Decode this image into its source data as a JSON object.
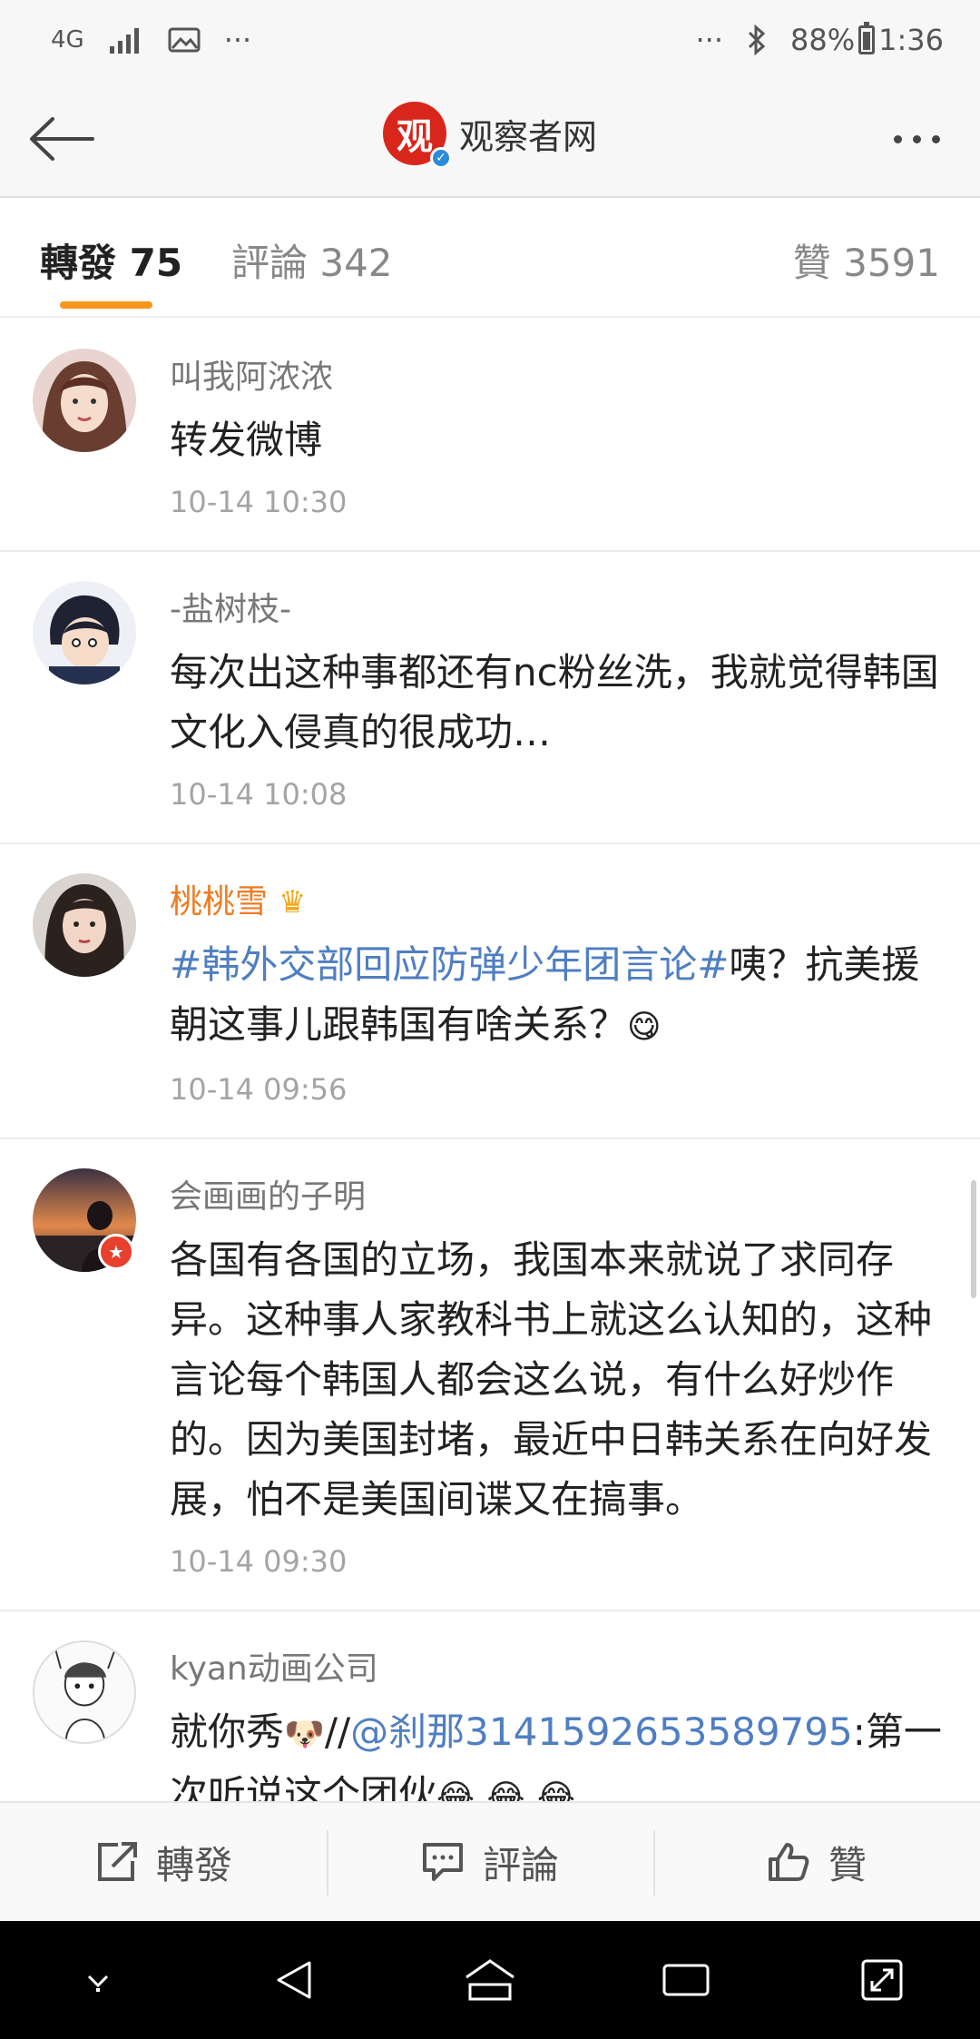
{
  "status_bar": {
    "network": "4G",
    "more_left": "···",
    "more_right": "···",
    "battery": "88%",
    "time": "1:36"
  },
  "header": {
    "title": "观察者网",
    "logo_text": "观"
  },
  "tabs": [
    {
      "label": "轉發 75",
      "active": true
    },
    {
      "label": "評論 342",
      "active": false
    },
    {
      "label": "贊 3591",
      "active": false
    }
  ],
  "comments": [
    {
      "username": "叫我阿浓浓",
      "content": "转发微博",
      "time": "10-14 10:30"
    },
    {
      "username": "-盐树枝-",
      "content": "每次出这种事都还有nc粉丝洗，我就觉得韩国文化入侵真的很成功…",
      "time": "10-14 10:08"
    },
    {
      "username": "桃桃雪",
      "topic": "#韩外交部回应防弹少年团言论#",
      "content": "咦？抗美援朝这事儿跟韩国有啥关系？",
      "time": "10-14 09:56"
    },
    {
      "username": "会画画的子明",
      "content": "各国有各国的立场，我国本来就说了求同存异。这种事人家教科书上就这么认知的，这种言论每个韩国人都会这么说，有什么好炒作的。因为美国封堵，最近中日韩关系在向好发展，怕不是美国间谍又在搞事。",
      "time": "10-14 09:30"
    },
    {
      "username": "kyan动画公司",
      "content_prefix": "就你秀",
      "separator": "//",
      "mention": "@刹那3141592653589795",
      "content_suffix": ":第一次听说这个团伙",
      "time": ""
    }
  ],
  "actions": {
    "repost": "轉發",
    "comment": "評論",
    "like": "贊"
  },
  "colors": {
    "accent": "#f7961e",
    "link": "#4f7ec2",
    "vip_name": "#f07a20",
    "brand_red": "#d9261c"
  }
}
